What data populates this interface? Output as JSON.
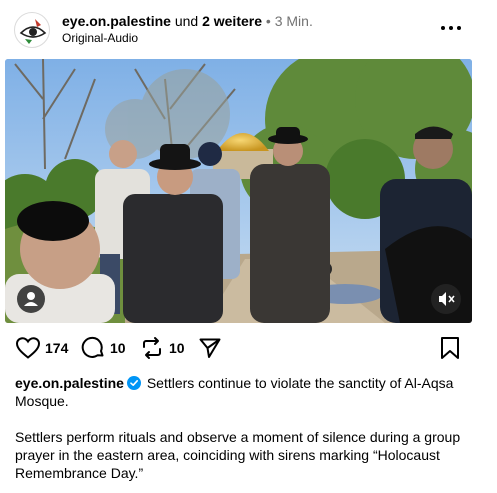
{
  "header": {
    "username": "eye.on.palestine",
    "connector": "und",
    "others": "2 weitere",
    "separator": "•",
    "time": "3 Min.",
    "audio": "Original-Audio"
  },
  "icons": {
    "avatar": "eye-logo-icon",
    "more": "more-options-icon",
    "like": "heart-icon",
    "comment": "comment-icon",
    "repost": "repost-icon",
    "share": "share-icon",
    "save": "bookmark-icon",
    "tag": "user-tag-icon",
    "mute": "muted-speaker-icon",
    "verified": "verified-badge-icon"
  },
  "stats": {
    "likes": "174",
    "comments": "10",
    "reposts": "10"
  },
  "caption": {
    "username": "eye.on.palestine",
    "text1": "Settlers continue to violate the sanctity of Al-Aqsa Mosque.",
    "text2": "Settlers perform rituals and observe a moment of silence during a group prayer in the eastern area, coinciding with sirens marking “Holocaust Remembrance Day.”"
  },
  "colors": {
    "text": "#000000",
    "secondary": "#737373",
    "verified": "#0095f6",
    "overlay_button": "#262626"
  }
}
